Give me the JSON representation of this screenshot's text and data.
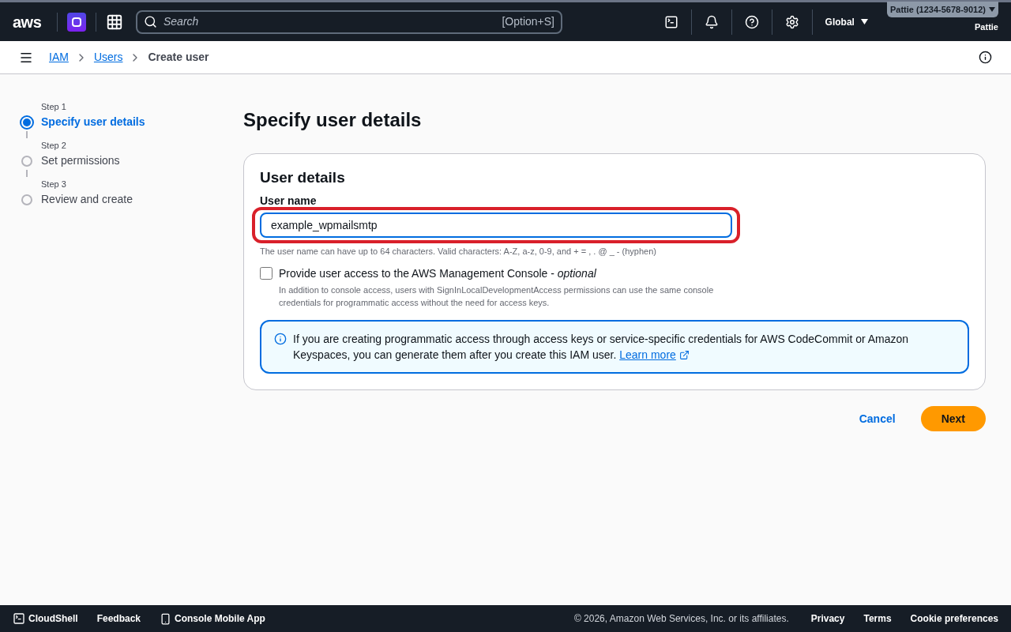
{
  "top_nav": {
    "logo": "aws",
    "search": {
      "placeholder": "Search",
      "shortcut": "[Option+S]"
    },
    "region": "Global",
    "account": "Pattie (1234-5678-9012)",
    "user": "Pattie"
  },
  "breadcrumbs": [
    {
      "label": "IAM",
      "kind": "link"
    },
    {
      "label": "Users",
      "kind": "link"
    },
    {
      "label": "Create user",
      "kind": "current"
    }
  ],
  "steps": [
    {
      "step": "Step 1",
      "label": "Specify user details",
      "selected": true
    },
    {
      "step": "Step 2",
      "label": "Set permissions",
      "selected": false
    },
    {
      "step": "Step 3",
      "label": "Review and create",
      "selected": false
    }
  ],
  "page_title": "Specify user details",
  "panel": {
    "title": "User details",
    "field": {
      "label": "User name",
      "value": "example_wpmailsmtp",
      "hint": "The user name can have up to 64 characters. Valid characters: A-Z, a-z, 0-9, and + = , . @ _ - (hyphen)",
      "highlighted": true
    },
    "console_access": {
      "label": "Provide user access to the AWS Management Console - ",
      "optional": "optional",
      "checked": false,
      "description": "In addition to console access, users with SignInLocalDevelopmentAccess permissions can use the same console credentials for programmatic access without the need for access keys."
    },
    "info": {
      "text": "If you are creating programmatic access through access keys or service-specific credentials for AWS CodeCommit or Amazon Keyspaces, you can generate them after you create this IAM user.",
      "link": "Learn more"
    }
  },
  "buttons": [
    {
      "label": "Cancel",
      "kind": "link"
    },
    {
      "label": "Next",
      "kind": "primary"
    }
  ],
  "footer": {
    "left": [
      "CloudShell",
      "Feedback",
      "Console Mobile App"
    ],
    "copyright": "© 2026, Amazon Web Services, Inc. or its affiliates.",
    "links": [
      "Privacy",
      "Terms",
      "Cookie preferences"
    ]
  }
}
